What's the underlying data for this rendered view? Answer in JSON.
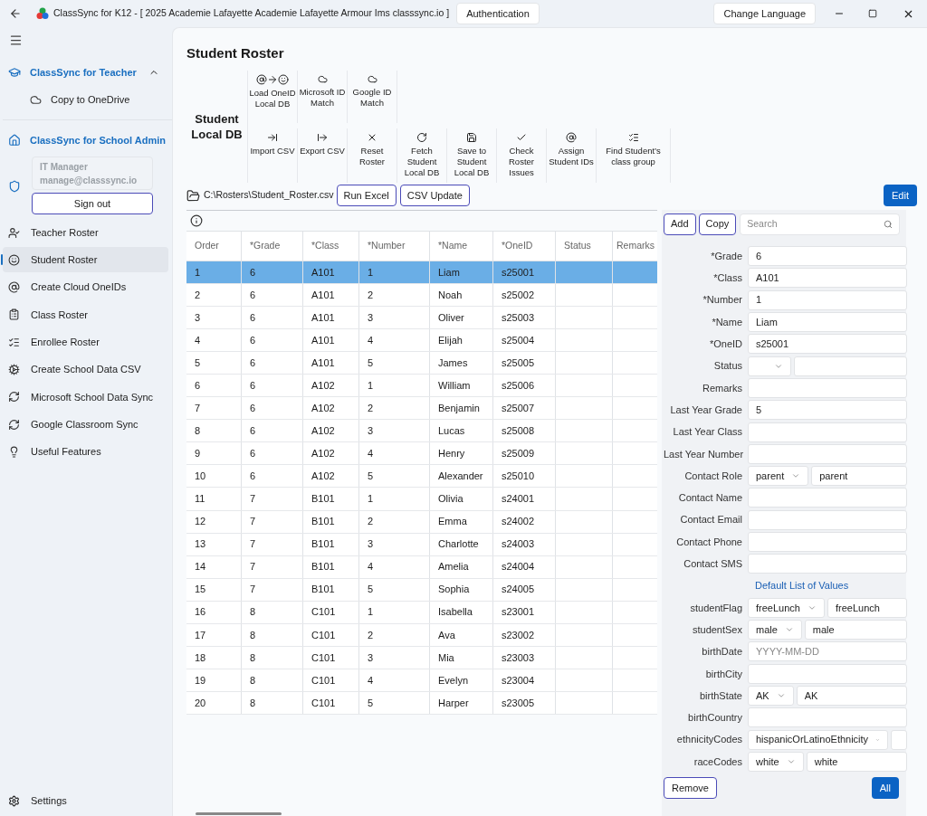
{
  "title_bar": {
    "title": "ClassSync for K12 - [ 2025 Academie Lafayette Academie Lafayette Armour Ims classsync.io ]",
    "auth_button": "Authentication",
    "language_button": "Change Language"
  },
  "sidebar": {
    "groups": [
      {
        "title": "ClassSync for Teacher",
        "expanded": true,
        "items": [
          "Copy to OneDrive"
        ]
      },
      {
        "title": "ClassSync for School Admin"
      }
    ],
    "account": {
      "name": "IT Manager",
      "email": "manage@classsync.io"
    },
    "sign_out": "Sign out",
    "nav": [
      {
        "label": "Teacher Roster",
        "selected": false
      },
      {
        "label": "Student Roster",
        "selected": true
      },
      {
        "label": "Create Cloud OneIDs",
        "selected": false
      },
      {
        "label": "Class Roster",
        "selected": false
      },
      {
        "label": "Enrollee Roster",
        "selected": false
      },
      {
        "label": "Create School Data CSV",
        "selected": false
      },
      {
        "label": "Microsoft School Data Sync",
        "selected": false
      },
      {
        "label": "Google Classroom Sync",
        "selected": false
      },
      {
        "label": "Useful Features",
        "selected": false
      }
    ],
    "settings": "Settings"
  },
  "page_title": "Student Roster",
  "toolbar": {
    "label": "Student Local DB",
    "rows": [
      [
        "Load OneID Local DB",
        "Microsoft ID Match",
        "Google ID Match"
      ],
      [
        "Import CSV",
        "Export CSV",
        "Reset Roster",
        "Fetch Student Local DB",
        "Save to Student Local DB",
        "Check Roster Issues",
        "Assign Student IDs",
        "Find Student’s class group"
      ]
    ]
  },
  "file_path": "C:\\Rosters\\Student_Roster.csv",
  "file_buttons": [
    "Run Excel",
    "CSV Update"
  ],
  "edit_button": "Edit",
  "table": {
    "columns": [
      "Order",
      "*Grade",
      "*Class",
      "*Number",
      "*Name",
      "*OneID",
      "Status",
      "Remarks"
    ],
    "rows": [
      {
        "cells": [
          "1",
          "6",
          "A101",
          "1",
          "Liam",
          "s25001"
        ],
        "selected": true
      },
      {
        "cells": [
          "2",
          "6",
          "A101",
          "2",
          "Noah",
          "s25002"
        ],
        "selected": false
      },
      {
        "cells": [
          "3",
          "6",
          "A101",
          "3",
          "Oliver",
          "s25003"
        ],
        "selected": false
      },
      {
        "cells": [
          "4",
          "6",
          "A101",
          "4",
          "Elijah",
          "s25004"
        ],
        "selected": false
      },
      {
        "cells": [
          "5",
          "6",
          "A101",
          "5",
          "James",
          "s25005"
        ],
        "selected": false
      },
      {
        "cells": [
          "6",
          "6",
          "A102",
          "1",
          "William",
          "s25006"
        ],
        "selected": false
      },
      {
        "cells": [
          "7",
          "6",
          "A102",
          "2",
          "Benjamin",
          "s25007"
        ],
        "selected": false
      },
      {
        "cells": [
          "8",
          "6",
          "A102",
          "3",
          "Lucas",
          "s25008"
        ],
        "selected": false
      },
      {
        "cells": [
          "9",
          "6",
          "A102",
          "4",
          "Henry",
          "s25009"
        ],
        "selected": false
      },
      {
        "cells": [
          "10",
          "6",
          "A102",
          "5",
          "Alexander",
          "s25010"
        ],
        "selected": false
      },
      {
        "cells": [
          "11",
          "7",
          "B101",
          "1",
          "Olivia",
          "s24001"
        ],
        "selected": false
      },
      {
        "cells": [
          "12",
          "7",
          "B101",
          "2",
          "Emma",
          "s24002"
        ],
        "selected": false
      },
      {
        "cells": [
          "13",
          "7",
          "B101",
          "3",
          "Charlotte",
          "s24003"
        ],
        "selected": false
      },
      {
        "cells": [
          "14",
          "7",
          "B101",
          "4",
          "Amelia",
          "s24004"
        ],
        "selected": false
      },
      {
        "cells": [
          "15",
          "7",
          "B101",
          "5",
          "Sophia",
          "s24005"
        ],
        "selected": false
      },
      {
        "cells": [
          "16",
          "8",
          "C101",
          "1",
          "Isabella",
          "s23001"
        ],
        "selected": false
      },
      {
        "cells": [
          "17",
          "8",
          "C101",
          "2",
          "Ava",
          "s23002"
        ],
        "selected": false
      },
      {
        "cells": [
          "18",
          "8",
          "C101",
          "3",
          "Mia",
          "s23003"
        ],
        "selected": false
      },
      {
        "cells": [
          "19",
          "8",
          "C101",
          "4",
          "Evelyn",
          "s23004"
        ],
        "selected": false
      },
      {
        "cells": [
          "20",
          "8",
          "C101",
          "5",
          "Harper",
          "s23005"
        ],
        "selected": false
      }
    ]
  },
  "detail": {
    "buttons": [
      "Add",
      "Copy"
    ],
    "search": {
      "placeholder": "Search"
    },
    "fields": [
      {
        "kind": "text",
        "label": "*Grade",
        "value": "6"
      },
      {
        "kind": "text",
        "label": "*Class",
        "value": "A101"
      },
      {
        "kind": "text",
        "label": "*Number",
        "value": "1"
      },
      {
        "kind": "text",
        "label": "*Name",
        "value": "Liam"
      },
      {
        "kind": "text",
        "label": "*OneID",
        "value": "s25001"
      },
      {
        "kind": "combo",
        "label": "Status"
      },
      {
        "kind": "text",
        "label": "Remarks"
      },
      {
        "kind": "text",
        "label": "Last Year Grade",
        "value": "5"
      },
      {
        "kind": "text",
        "label": "Last Year Class"
      },
      {
        "kind": "text",
        "label": "Last Year Number"
      },
      {
        "kind": "combo",
        "label": "Contact Role",
        "option": "parent",
        "value": "parent"
      },
      {
        "kind": "text",
        "label": "Contact Name"
      },
      {
        "kind": "text",
        "label": "Contact Email"
      },
      {
        "kind": "text",
        "label": "Contact Phone"
      },
      {
        "kind": "text",
        "label": "Contact SMS"
      },
      {
        "kind": "link",
        "label": "Default List of Values"
      },
      {
        "kind": "combo",
        "label": "studentFlag",
        "option": "freeLunch",
        "value": "freeLunch"
      },
      {
        "kind": "combo",
        "label": "studentSex",
        "option": "male",
        "value": "male"
      },
      {
        "kind": "text",
        "label": "birthDate",
        "placeholder": "YYYY-MM-DD"
      },
      {
        "kind": "text",
        "label": "birthCity"
      },
      {
        "kind": "combo",
        "label": "birthState",
        "option": "AK",
        "value": "AK"
      },
      {
        "kind": "text",
        "label": "birthCountry"
      },
      {
        "kind": "wide_combo",
        "label": "ethnicityCodes",
        "option": "hispanicOrLatinoEthnicity"
      },
      {
        "kind": "combo",
        "label": "raceCodes",
        "option": "white",
        "value": "white"
      }
    ],
    "remove_button": "Remove",
    "all_button": "All"
  }
}
